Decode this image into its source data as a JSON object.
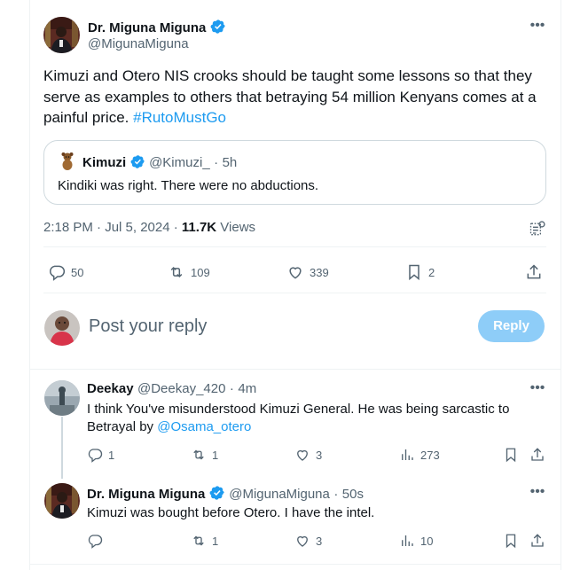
{
  "main_tweet": {
    "author_name": "Dr. Miguna Miguna",
    "author_handle": "@MigunaMiguna",
    "text_main": "Kimuzi and Otero NIS crooks should be taught some lessons so that they serve as examples to others that betraying 54 million Kenyans comes at a painful price.",
    "hashtag": "#RutoMustGo",
    "quote": {
      "author_name": "Kimuzi",
      "author_handle": "@Kimuzi_",
      "time": "5h",
      "text": "Kindiki was right. There were no abductions."
    },
    "time": "2:18 PM · Jul 5, 2024 ·",
    "views_count": "11.7K",
    "views_label": "Views",
    "stats": {
      "replies": "50",
      "retweets": "109",
      "likes": "339",
      "bookmarks": "2"
    }
  },
  "composer": {
    "placeholder": "Post your reply",
    "button_label": "Reply"
  },
  "replies": [
    {
      "author_name": "Deekay",
      "author_handle": "@Deekay_420",
      "time": "4m",
      "text": "I think You've misunderstood Kimuzi General. He was being sarcastic to Betrayal by",
      "mention": "@Osama_otero",
      "stats": {
        "replies": "1",
        "retweets": "1",
        "likes": "3",
        "views": "273"
      }
    },
    {
      "author_name": "Dr. Miguna Miguna",
      "author_handle": "@MigunaMiguna",
      "time": "50s",
      "text": "Kimuzi was bought before Otero. I have the intel.",
      "stats": {
        "replies": "",
        "retweets": "1",
        "likes": "3",
        "views": "10"
      }
    }
  ],
  "colors": {
    "accent": "#1d9bf0",
    "reply_button_disabled": "#8ecdf8",
    "secondary_text": "#536471",
    "border": "#eff3f4"
  }
}
